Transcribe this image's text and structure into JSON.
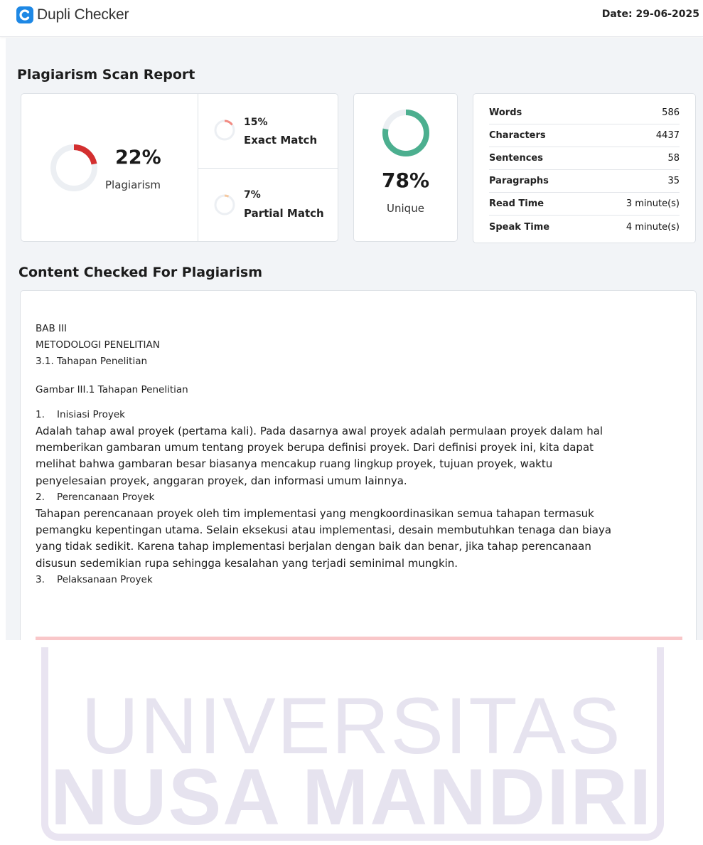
{
  "header": {
    "brand": "Dupli Checker",
    "date": "Date: 29-06-2025"
  },
  "report": {
    "title": "Plagiarism Scan Report",
    "plagiarism": {
      "percent": "22%",
      "label": "Plagiarism",
      "value": 22
    },
    "exact": {
      "percent": "15%",
      "label": "Exact Match",
      "value": 15
    },
    "partial": {
      "percent": "7%",
      "label": "Partial Match",
      "value": 7
    },
    "unique": {
      "percent": "78%",
      "label": "Unique",
      "value": 78
    },
    "stats": [
      {
        "label": "Words",
        "value": "586"
      },
      {
        "label": "Characters",
        "value": "4437"
      },
      {
        "label": "Sentences",
        "value": "58"
      },
      {
        "label": "Paragraphs",
        "value": "35"
      },
      {
        "label": "Read Time",
        "value": "3 minute(s)"
      },
      {
        "label": "Speak Time",
        "value": "4 minute(s)"
      }
    ]
  },
  "content": {
    "title": "Content Checked For Plagiarism",
    "lines": [
      "BAB III",
      "METODOLOGI PENELITIAN",
      "3.1. Tahapan Penelitian",
      "",
      "Gambar III.1 Tahapan Penelitian",
      "",
      "1.    Inisiasi Proyek",
      "Adalah tahap awal proyek (pertama kali). Pada dasarnya awal proyek adalah permulaan proyek dalam hal",
      "memberikan gambaran umum tentang proyek berupa definisi proyek. Dari definisi proyek ini, kita dapat",
      "melihat bahwa gambaran besar biasanya mencakup ruang lingkup proyek, tujuan proyek, waktu",
      "penyelesaian proyek, anggaran proyek, dan informasi umum lainnya.",
      "2.    Perencanaan Proyek",
      "Tahapan perencanaan proyek oleh tim implementasi yang mengkoordinasikan semua tahapan termasuk",
      "pemangku kepentingan utama. Selain eksekusi atau implementasi, desain membutuhkan tenaga dan biaya",
      "yang tidak sedikit. Karena tahap implementasi berjalan dengan baik dan benar, jika tahap perencanaan",
      "disusun sedemikian rupa sehingga kesalahan yang terjadi seminimal mungkin.",
      "3.    Pelaksanaan Proyek"
    ]
  },
  "watermark": {
    "line1": "UNIVERSITAS",
    "line2": "NUSA MANDIRI"
  },
  "colors": {
    "plagiarism": "#d32f2f",
    "unique": "#4caf8f",
    "exact": "#f28b82",
    "partial": "#f6c9a0",
    "track": "#eceff3"
  }
}
